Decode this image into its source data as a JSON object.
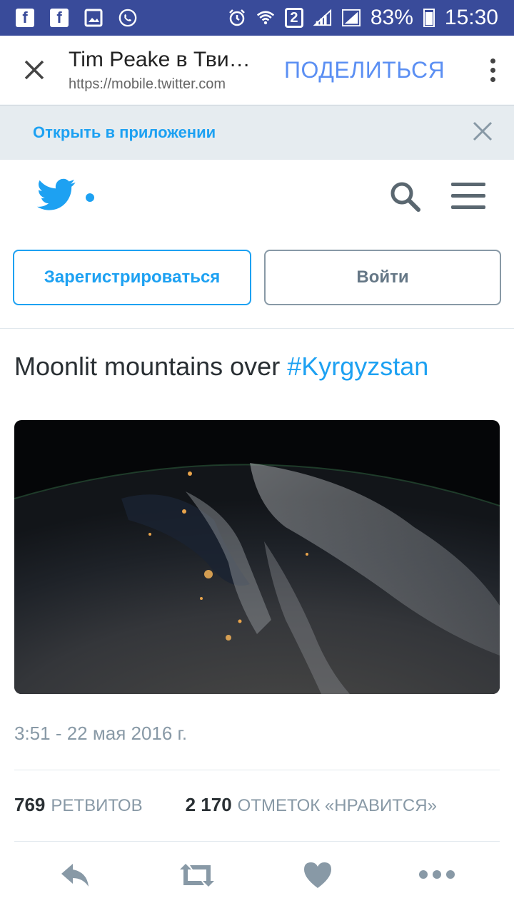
{
  "status_bar": {
    "battery": "83%",
    "time": "15:30",
    "sim_badge": "2",
    "left_icons": [
      "facebook-icon",
      "facebook-icon",
      "image-icon",
      "phone-icon"
    ],
    "right_icons": [
      "alarm-icon",
      "wifi-icon",
      "sim-icon",
      "signal-icon",
      "signal-icon",
      "battery-icon"
    ]
  },
  "browser": {
    "title": "Tim Peake в Тви…",
    "url": "https://mobile.twitter.com",
    "share_label": "ПОДЕЛИТЬСЯ"
  },
  "open_in_app": {
    "label": "Открыть в приложении"
  },
  "auth": {
    "signup_label": "Зарегистрироваться",
    "login_label": "Войти"
  },
  "tweet": {
    "text": "Moonlit mountains over ",
    "hashtag": "#Kyrgyzstan",
    "timestamp": "3:51 - 22 мая 2016 г.",
    "retweets_count": "769",
    "retweets_label": "РЕТВИТОВ",
    "likes_count": "2 170",
    "likes_label": "ОТМЕТОК «НРАВИТСЯ»"
  },
  "colors": {
    "accent": "#1da1f2",
    "status_bar": "#394b9a",
    "share": "#5b8ff3"
  }
}
